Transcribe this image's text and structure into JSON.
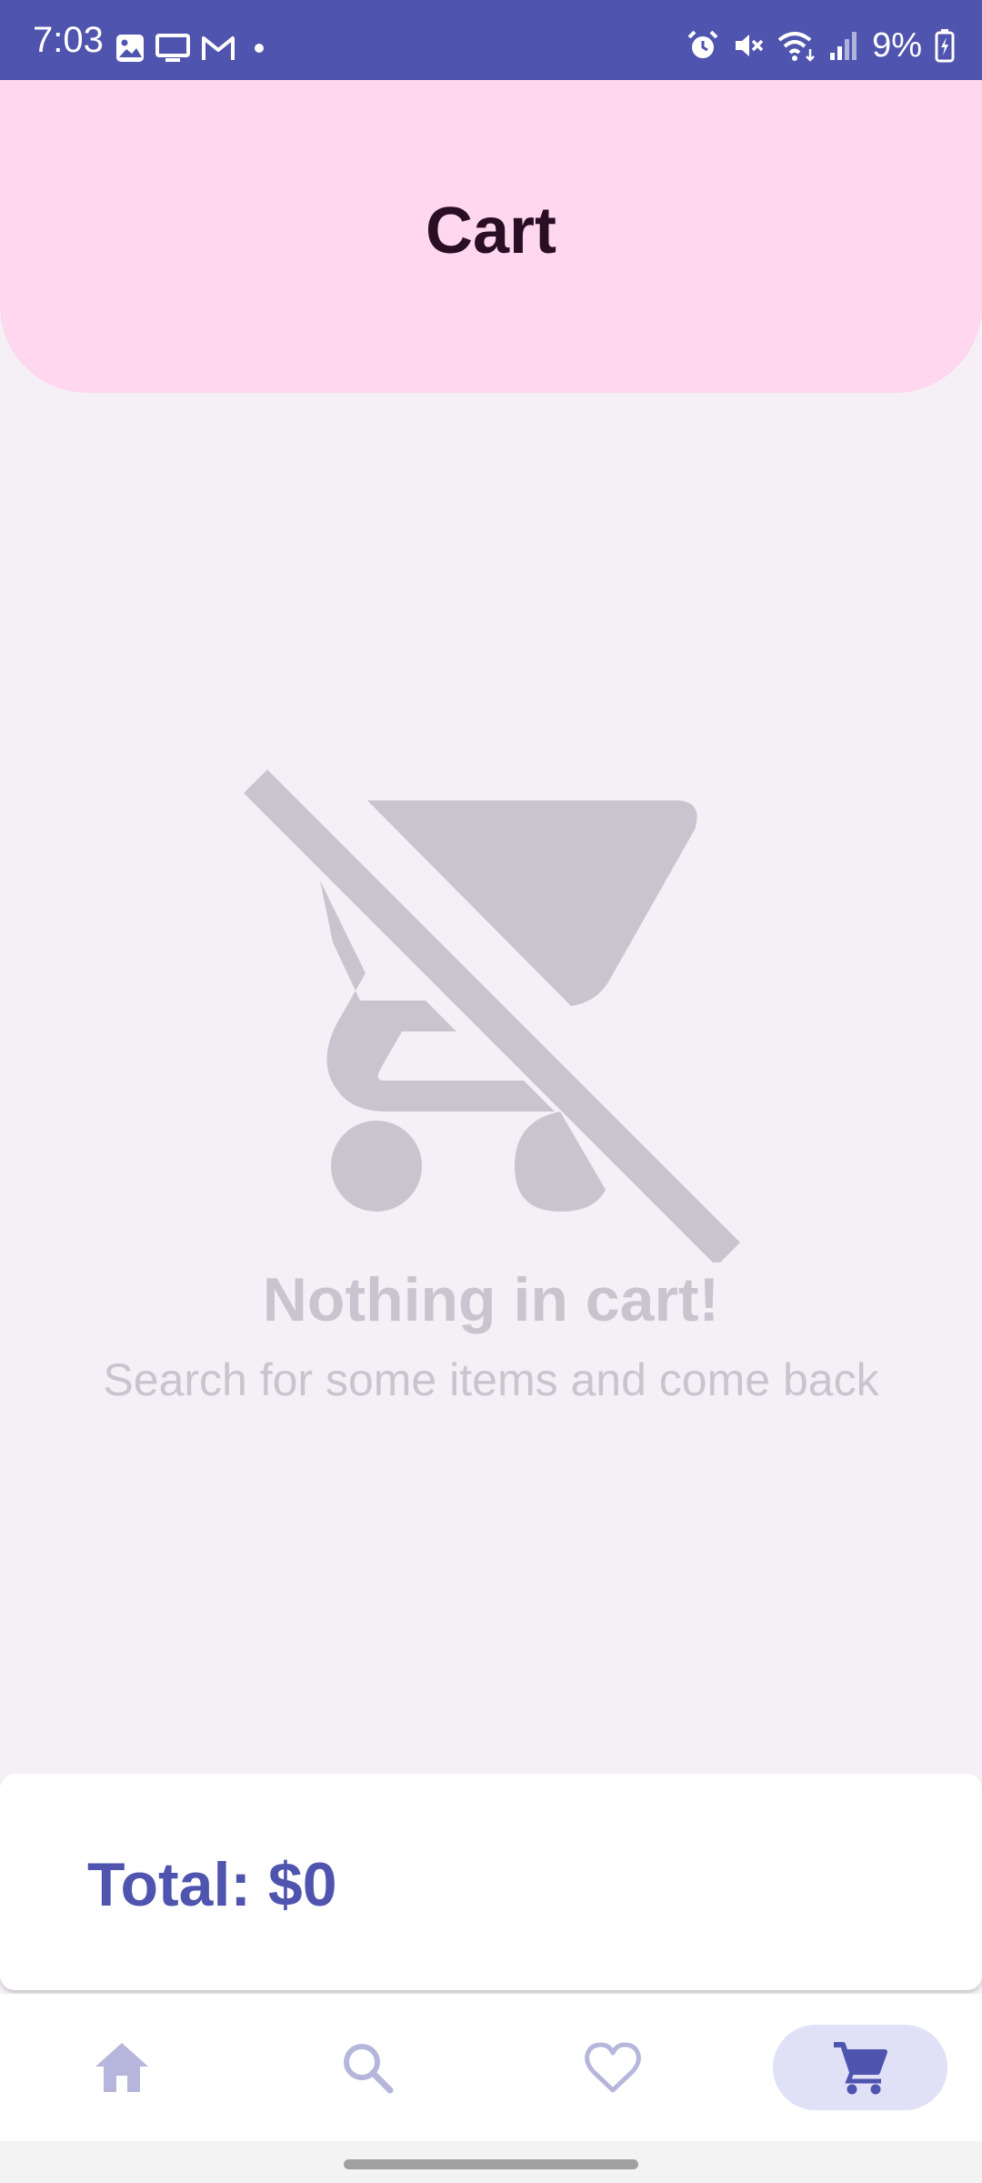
{
  "status_bar": {
    "time": "7:03",
    "battery": "9%",
    "left_icons": [
      "image-icon",
      "tv-icon",
      "gmail-icon",
      "dot-icon"
    ],
    "right_icons": [
      "alarm-icon",
      "mute-icon",
      "wifi-icon",
      "signal-icon",
      "battery-icon"
    ]
  },
  "header": {
    "title": "Cart"
  },
  "empty_state": {
    "icon": "cart-off-icon",
    "title": "Nothing in cart!",
    "subtitle": "Search for some items and come back"
  },
  "total": {
    "label": "Total: $0"
  },
  "bottom_nav": {
    "items": [
      {
        "name": "home",
        "icon": "home-icon",
        "active": false
      },
      {
        "name": "search",
        "icon": "search-icon",
        "active": false
      },
      {
        "name": "favorites",
        "icon": "heart-icon",
        "active": false
      },
      {
        "name": "cart",
        "icon": "cart-icon",
        "active": true
      }
    ]
  },
  "colors": {
    "primary": "#4f54ae",
    "header_bg": "#ffd7ee",
    "page_bg": "#f5f0f6",
    "muted": "#c8c5cf",
    "nav_active_bg": "#e0e0f7",
    "nav_inactive": "#b6b6dc"
  }
}
